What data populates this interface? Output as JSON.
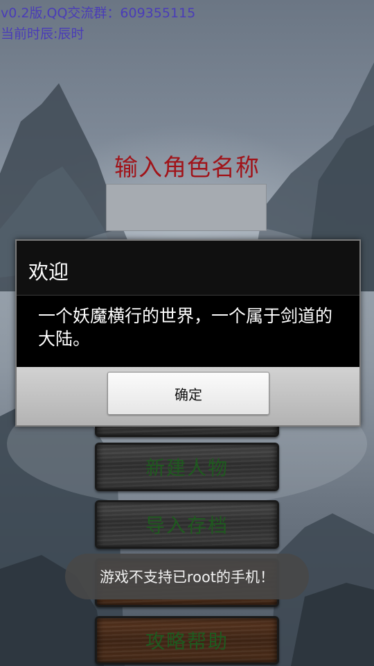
{
  "header": {
    "version": "v0.2版,QQ交流群：609355115",
    "shichen": "当前时辰:辰时"
  },
  "name_form": {
    "title": "输入角色名称",
    "input_value": ""
  },
  "menu": {
    "buttons": [
      {
        "label": ""
      },
      {
        "label": "新建人物"
      },
      {
        "label": "导入存档"
      },
      {
        "label": ""
      },
      {
        "label": "攻略帮助"
      }
    ]
  },
  "dialog": {
    "title": "欢迎",
    "message": "一个妖魔横行的世界，一个属于剑道的大陆。",
    "ok_label": "确定"
  },
  "toast": {
    "text": "游戏不支持已root的手机！"
  },
  "colors": {
    "info_text": "#4a3cb8",
    "title_red": "#a0141a",
    "button_text_green": "#1f5a1f"
  }
}
